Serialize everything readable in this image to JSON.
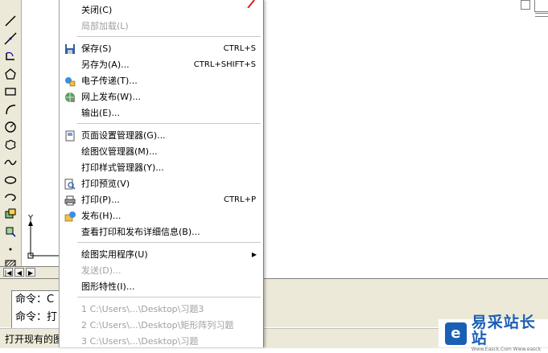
{
  "menu": {
    "items": [
      {
        "label": "关闭(C)",
        "shortcut": "",
        "disabled": false,
        "icon": ""
      },
      {
        "label": "局部加载(L)",
        "shortcut": "",
        "disabled": true,
        "icon": ""
      },
      {
        "label": "保存(S)",
        "shortcut": "CTRL+S",
        "disabled": false,
        "icon": "floppy-disk-icon"
      },
      {
        "label": "另存为(A)...",
        "shortcut": "CTRL+SHIFT+S",
        "disabled": false,
        "icon": ""
      },
      {
        "label": "电子传递(T)...",
        "shortcut": "",
        "disabled": false,
        "icon": "etransmit-icon"
      },
      {
        "label": "网上发布(W)...",
        "shortcut": "",
        "disabled": false,
        "icon": "publish-web-icon"
      },
      {
        "label": "输出(E)...",
        "shortcut": "",
        "disabled": false,
        "icon": ""
      },
      {
        "label": "页面设置管理器(G)...",
        "shortcut": "",
        "disabled": false,
        "icon": "page-setup-icon"
      },
      {
        "label": "绘图仪管理器(M)...",
        "shortcut": "",
        "disabled": false,
        "icon": ""
      },
      {
        "label": "打印样式管理器(Y)...",
        "shortcut": "",
        "disabled": false,
        "icon": ""
      },
      {
        "label": "打印预览(V)",
        "shortcut": "",
        "disabled": false,
        "icon": "print-preview-icon"
      },
      {
        "label": "打印(P)...",
        "shortcut": "CTRL+P",
        "disabled": false,
        "icon": "printer-icon"
      },
      {
        "label": "发布(H)...",
        "shortcut": "",
        "disabled": false,
        "icon": "publish-icon"
      },
      {
        "label": "查看打印和发布详细信息(B)...",
        "shortcut": "",
        "disabled": false,
        "icon": ""
      },
      {
        "label": "绘图实用程序(U)",
        "shortcut": "",
        "disabled": false,
        "icon": "",
        "submenu": true
      },
      {
        "label": "发送(D)...",
        "shortcut": "",
        "disabled": true,
        "icon": ""
      },
      {
        "label": "图形特性(I)...",
        "shortcut": "",
        "disabled": false,
        "icon": ""
      },
      {
        "label": "1 C:\\Users\\...\\Desktop\\习题3",
        "shortcut": "",
        "disabled": true,
        "icon": ""
      },
      {
        "label": "2 C:\\Users\\...\\Desktop\\矩形阵列习题",
        "shortcut": "",
        "disabled": true,
        "icon": ""
      },
      {
        "label": "3 C:\\Users\\...\\Desktop\\习题",
        "shortcut": "",
        "disabled": true,
        "icon": ""
      }
    ]
  },
  "command": {
    "line1": "命令：C",
    "line2": "命令：打"
  },
  "status": {
    "text": "打开现有的图"
  },
  "ucs": {
    "axis_label": "Y"
  },
  "tabs": {
    "first": "|◀",
    "prev": "◀",
    "next": "▶"
  },
  "watermark": {
    "logo": "e",
    "main": "易采站长站",
    "sub": "Www.Easck.Com Www.easck"
  },
  "colors": {
    "menu_bg": "#ffffff",
    "toolbar_bg": "#ece9d8",
    "disabled_text": "#a0a0a0",
    "brand": "#1a5fb4"
  }
}
